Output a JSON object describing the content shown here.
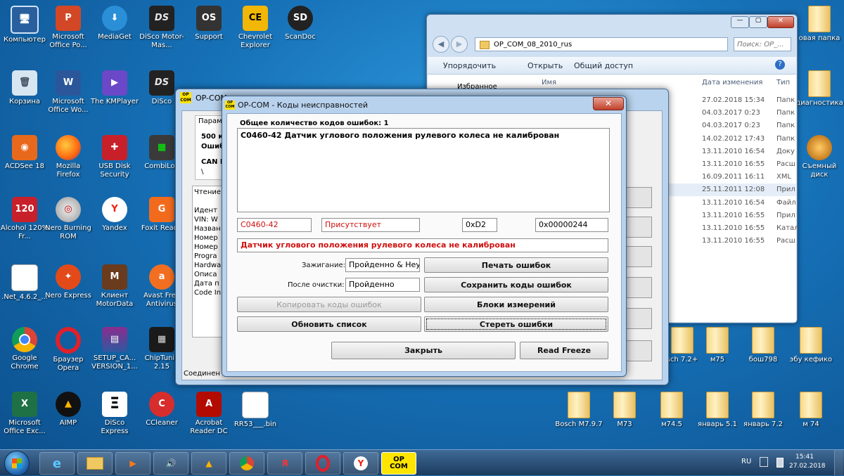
{
  "desktop": {
    "icons_col1": [
      "Компьютер",
      "Корзина",
      "ACDSee 18",
      "Alcohol 120% Fr...",
      ".Net_4.6.2_...",
      "Google Chrome",
      "Microsoft Office Exc..."
    ],
    "icons_col2": [
      "Microsoft Office Po...",
      "Microsoft Office Wo...",
      "Mozilla Firefox",
      "Nero Burning ROM",
      "Nero Express",
      "Браузер Opera",
      "AIMP"
    ],
    "icons_col3": [
      "MediaGet",
      "The KMPlayer",
      "USB Disk Security",
      "Yandex",
      "Клиент MotorData",
      "SETUP_CA... VERSION_1...",
      "DiSco Express"
    ],
    "icons_col4": [
      "DiSco Motor-Mas...",
      "DiSco",
      "CombiLoa",
      "Foxit Reade",
      "Avast Free Antivirus",
      "ChipTunin 2.15",
      "CCleaner"
    ],
    "icons_top_row": [
      "Support",
      "Chevrolet Explorer",
      "ScanDoc"
    ],
    "icons_bottom_row": [
      "Acrobat Reader DC",
      "RR53___.bin"
    ],
    "right_icons": [
      "овая папка",
      "диагностика",
      "Съемный диск"
    ],
    "folders_row1": [
      "sch 7.2+",
      "м75",
      "бош798",
      "эбу кефико"
    ],
    "folders_row2": [
      "Bosch M7.9.7",
      "M73",
      "м74.5",
      "январь 5.1",
      "январь 7.2",
      "м 74"
    ]
  },
  "explorer": {
    "path": "OP_COM_08_2010_rus",
    "search_placeholder": "Поиск: OP_...",
    "toolbar": {
      "organize": "Упорядочить",
      "open": "Открыть",
      "share": "Общий доступ"
    },
    "sidebar_first": "Избранное",
    "columns": {
      "name": "Имя",
      "date": "Дата изменения",
      "type": "Тип"
    },
    "rows": [
      {
        "date": "27.02.2018 15:34",
        "type": "Папк"
      },
      {
        "date": "04.03.2017 0:23",
        "type": "Папк"
      },
      {
        "date": "04.03.2017 0:23",
        "type": "Папк"
      },
      {
        "date": "14.02.2012 17:43",
        "type": "Папк"
      },
      {
        "date": "13.11.2010 16:54",
        "type": "Доку"
      },
      {
        "date": "13.11.2010 16:55",
        "type": "Расш"
      },
      {
        "date": "16.09.2011 16:11",
        "type": "XML"
      },
      {
        "date": "25.11.2011 12:08",
        "type": "Прил"
      },
      {
        "date": "13.11.2010 16:54",
        "type": "Файл"
      },
      {
        "date": "13.11.2010 16:55",
        "type": "Прил"
      },
      {
        "date": "13.11.2010 16:55",
        "type": "Катал"
      },
      {
        "date": "13.11.2010 16:55",
        "type": "Расш"
      }
    ]
  },
  "backwin": {
    "title": "OP-COM",
    "param_label": "Парам",
    "line1": "500 к",
    "line2": "Ошиб",
    "line3": "CAN I",
    "line4": "\\",
    "list": [
      "Чтение",
      "",
      "Идент",
      "VIN: W",
      "Назван",
      "Номер",
      "Номер",
      "Progra",
      "Hardwa",
      "Описа",
      "Дата п",
      "Code In"
    ],
    "status": "Соединен"
  },
  "dialog": {
    "title": "OP-COM - Коды неисправностей",
    "logo_top": "OP",
    "logo_bottom": "COM",
    "close": "✕",
    "count_label": "Общее количество кодов ошибок:",
    "count": "1",
    "list_item": "C0460-42 Датчик углового положения рулевого колеса не калиброван",
    "code": "C0460-42",
    "state": "Присутствует",
    "hex1": "0xD2",
    "hex2": "0x00000244",
    "description": "Датчик углового положения рулевого колеса не калиброван",
    "ignition_label": "Зажигание:",
    "ignition_value": "Пройденно & Неу.",
    "after_clear_label": "После очистки:",
    "after_clear_value": "Пройденно",
    "btn_print": "Печать ошибок",
    "btn_save": "Сохранить коды ошибок",
    "btn_copy": "Копировать коды ошибок",
    "btn_blocks": "Блоки измерений",
    "btn_refresh": "Обновить список",
    "btn_clear": "Стереть ошибки",
    "btn_close": "Закрыть",
    "btn_freeze": "Read Freeze"
  },
  "taskbar": {
    "lang": "RU",
    "time": "15:41",
    "date": "27.02.2018",
    "opcom_top": "OP",
    "opcom_bottom": "COM"
  }
}
